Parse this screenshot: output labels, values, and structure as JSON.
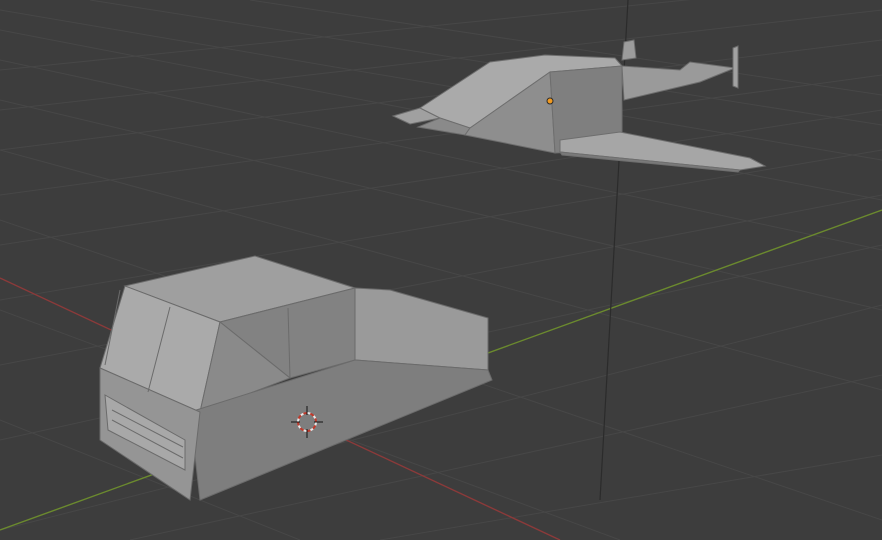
{
  "viewport": {
    "mode": "3d-viewport",
    "colors": {
      "background": "#3d3d3d",
      "grid": "#4a4a4a",
      "x_axis": "#8b3a3a",
      "y_axis": "#6b8a2e",
      "z_axis": "#2b2b2b",
      "mesh_light": "#a6a6a6",
      "mesh_mid": "#8f8f8f",
      "mesh_dark": "#7b7b7b",
      "origin": "#f29a1f"
    },
    "objects": [
      {
        "name": "truck",
        "icon": "mesh-object-icon"
      },
      {
        "name": "aircraft",
        "icon": "mesh-object-icon"
      }
    ],
    "cursor": {
      "icon": "3d-cursor-icon"
    }
  }
}
